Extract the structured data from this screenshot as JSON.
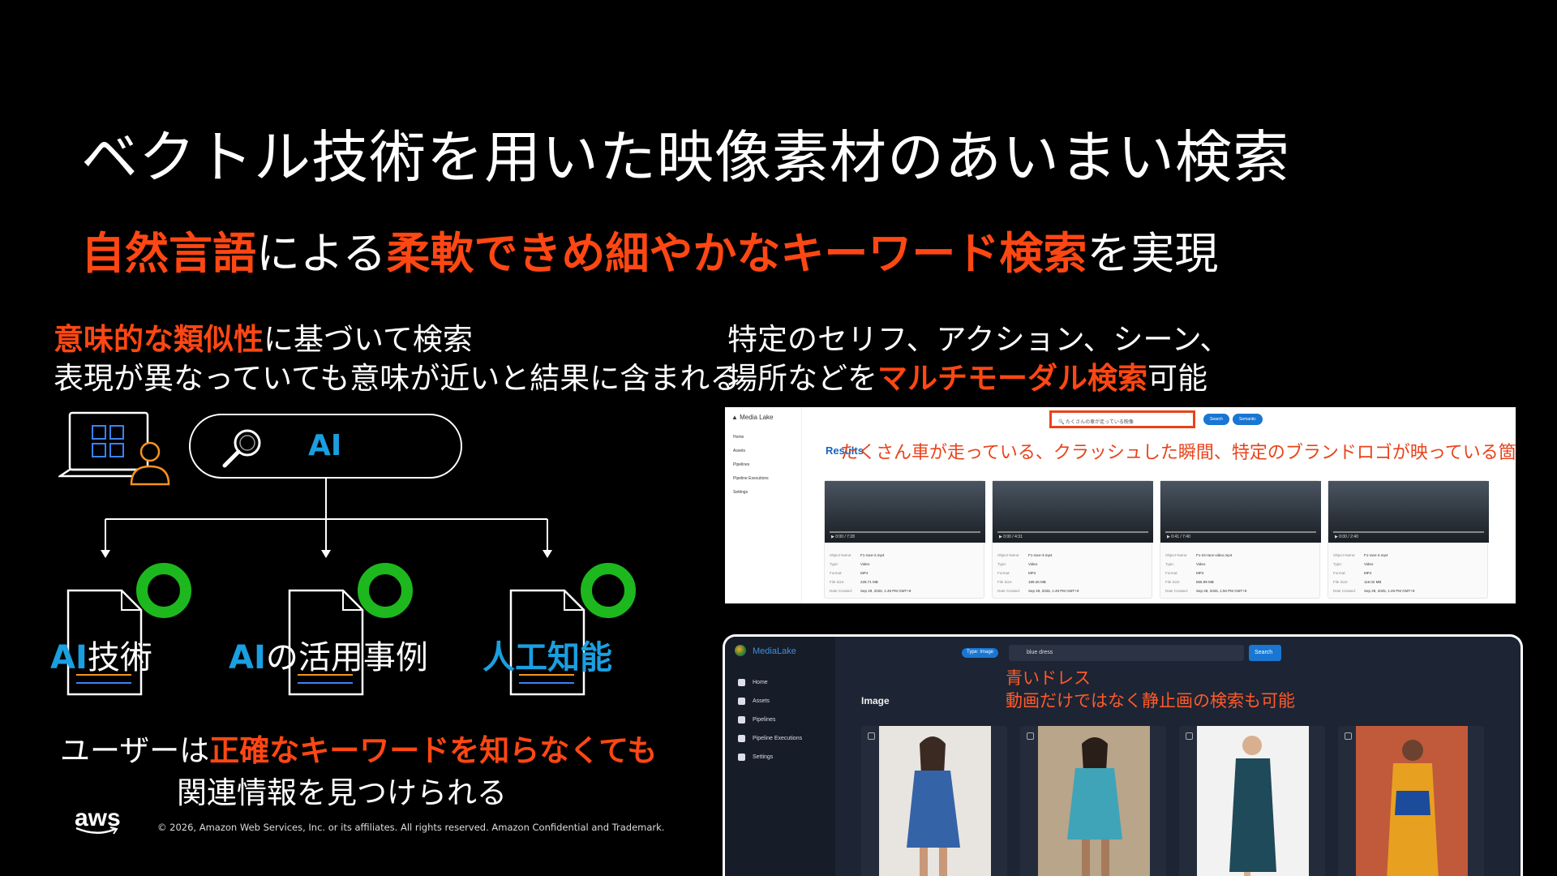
{
  "slide": {
    "title": "ベクトル技術を用いた映像素材のあいまい検索",
    "subtitle": {
      "part1": "自然言語",
      "part2": "による",
      "part3": "柔軟できめ細やかなキーワード検索",
      "part4": "を実現"
    }
  },
  "left": {
    "line1_highlight": "意味的な類似性",
    "line1_rest": "に基づいて検索",
    "line2": "表現が異なっていても意味が近いと結果に含まれる",
    "search_query": "AI",
    "results": [
      {
        "ai": "AI",
        "rest": "技術"
      },
      {
        "ai": "AI",
        "rest": "の活用事例"
      },
      {
        "ai": "人工知能",
        "rest": ""
      }
    ],
    "note_prefix": "ユーザーは",
    "note_highlight": "正確なキーワードを知らなくても",
    "note_line2": "関連情報を見つけられる"
  },
  "right": {
    "line1": "特定のセリフ、アクション、シーン、",
    "line2_prefix": "場所などを",
    "line2_highlight": "マルチモーダル検索",
    "line2_suffix": "可能"
  },
  "shot1": {
    "brand": "Media Lake",
    "nav": [
      "Home",
      "Assets",
      "Pipelines",
      "Pipeline Executions",
      "Settings"
    ],
    "search_value": "たくさんの車が走っている映像",
    "search_button": "Search",
    "semantic_button": "Semantic",
    "results_label": "Results",
    "overlay_text": "たくさん車が走っている、クラッシュした瞬間、特定のブランドロゴが映っている箇所、など。",
    "meta_labels": [
      "Object Name:",
      "Type:",
      "Format:",
      "File Size:",
      "Date Created:"
    ],
    "cards": [
      {
        "time": "0:00 / 7:28",
        "name": "F1-race-2.mp4",
        "type": "Video",
        "format": "MP4",
        "size": "228.71 MB",
        "date": "Sep 29, 2025, 1:49 PM GMT+9"
      },
      {
        "time": "0:00 / 4:31",
        "name": "F1-race-3.mp4",
        "type": "Video",
        "format": "MP4",
        "size": "189.26 MB",
        "date": "Sep 29, 2025, 1:49 PM GMT+9"
      },
      {
        "time": "0:41 / 7:40",
        "name": "F1-24-race-video.mp4",
        "type": "Video",
        "format": "MP4",
        "size": "565.99 MB",
        "date": "Sep 29, 2025, 1:50 PM GMT+9"
      },
      {
        "time": "0:00 / 2:40",
        "name": "F1-race-4.mp4",
        "type": "Video",
        "format": "MP4",
        "size": "116.02 MB",
        "date": "Sep 29, 2025, 1:49 PM GMT+9"
      }
    ]
  },
  "shot2": {
    "brand": "MediaLake",
    "nav": [
      "Home",
      "Assets",
      "Pipelines",
      "Pipeline Executions",
      "Settings"
    ],
    "chip": "Type: Image",
    "search_value": "blue dress",
    "search_button": "Search",
    "section_title": "Image",
    "overlay_line1": "青いドレス",
    "overlay_line2": "動画だけではなく静止画の検索も可能"
  },
  "footer": {
    "logo": "aws",
    "copyright": "© 2026, Amazon Web Services, Inc. or its affiliates. All rights reserved. Amazon Confidential and Trademark."
  }
}
